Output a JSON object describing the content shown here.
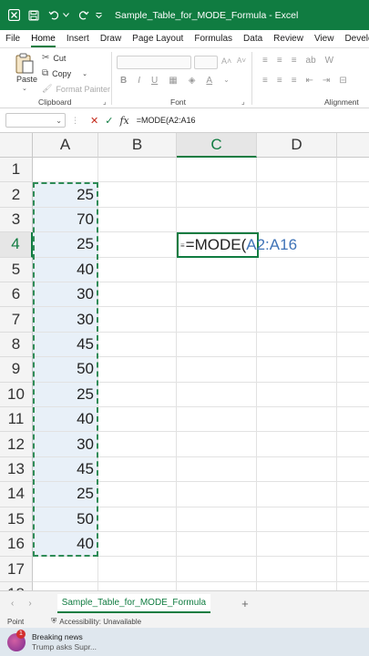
{
  "titlebar": {
    "title": "Sample_Table_for_MODE_Formula  -  Excel"
  },
  "menu": {
    "tabs": [
      "File",
      "Home",
      "Insert",
      "Draw",
      "Page Layout",
      "Formulas",
      "Data",
      "Review",
      "View",
      "Developer"
    ],
    "active": "Home"
  },
  "ribbon": {
    "clipboard": {
      "paste_label": "Paste",
      "cut_label": "Cut",
      "copy_label": "Copy",
      "format_painter_label": "Format Painter",
      "group_label": "Clipboard"
    },
    "font_group_label": "Font",
    "alignment_group_label": "Alignment",
    "font_buttons": [
      "B",
      "I",
      "U"
    ]
  },
  "formula_bar": {
    "name_box": "",
    "formula": "=MODE(A2:A16"
  },
  "grid": {
    "columns": [
      "A",
      "B",
      "C",
      "D"
    ],
    "selected_column": "C",
    "rows": [
      "1",
      "2",
      "3",
      "4",
      "5",
      "6",
      "7",
      "8",
      "9",
      "10",
      "11",
      "12",
      "13",
      "14",
      "15",
      "16",
      "17",
      "18"
    ],
    "selected_row": "4",
    "column_a_values": [
      "",
      "25",
      "70",
      "25",
      "40",
      "30",
      "30",
      "45",
      "50",
      "25",
      "40",
      "30",
      "45",
      "25",
      "50",
      "40",
      "",
      ""
    ],
    "active_cell": {
      "prefix": "=MODE(",
      "reference": "A2:A16"
    }
  },
  "sheets": {
    "active_sheet": "Sample_Table_for_MODE_Formula"
  },
  "status": {
    "mode": "Point",
    "accessibility": "Accessibility: Unavailable"
  },
  "taskbar": {
    "news_badge": "1",
    "news_title": "Breaking news",
    "news_sub": "Trump asks Supr..."
  }
}
